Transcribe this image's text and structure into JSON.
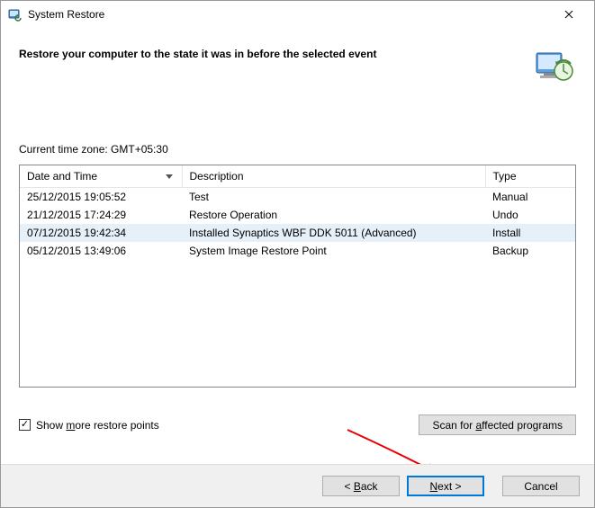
{
  "window": {
    "title": "System Restore"
  },
  "header": {
    "heading": "Restore your computer to the state it was in before the selected event"
  },
  "timezone": {
    "label": "Current time zone: GMT+05:30"
  },
  "table": {
    "headers": {
      "date": "Date and Time",
      "desc": "Description",
      "type": "Type"
    },
    "rows": [
      {
        "date": "25/12/2015 19:05:52",
        "desc": "Test",
        "type": "Manual",
        "selected": false
      },
      {
        "date": "21/12/2015 17:24:29",
        "desc": "Restore Operation",
        "type": "Undo",
        "selected": false
      },
      {
        "date": "07/12/2015 19:42:34",
        "desc": "Installed Synaptics WBF DDK 5011 (Advanced)",
        "type": "Install",
        "selected": true
      },
      {
        "date": "05/12/2015 13:49:06",
        "desc": "System Image Restore Point",
        "type": "Backup",
        "selected": false
      }
    ]
  },
  "checkbox": {
    "checked": true,
    "label_pre": "Show ",
    "label_accel": "m",
    "label_post": "ore restore points"
  },
  "buttons": {
    "scan_pre": "Scan for ",
    "scan_accel": "a",
    "scan_post": "ffected programs",
    "back_pre": "< ",
    "back_accel": "B",
    "back_post": "ack",
    "next_accel": "N",
    "next_post": "ext >",
    "cancel": "Cancel"
  }
}
